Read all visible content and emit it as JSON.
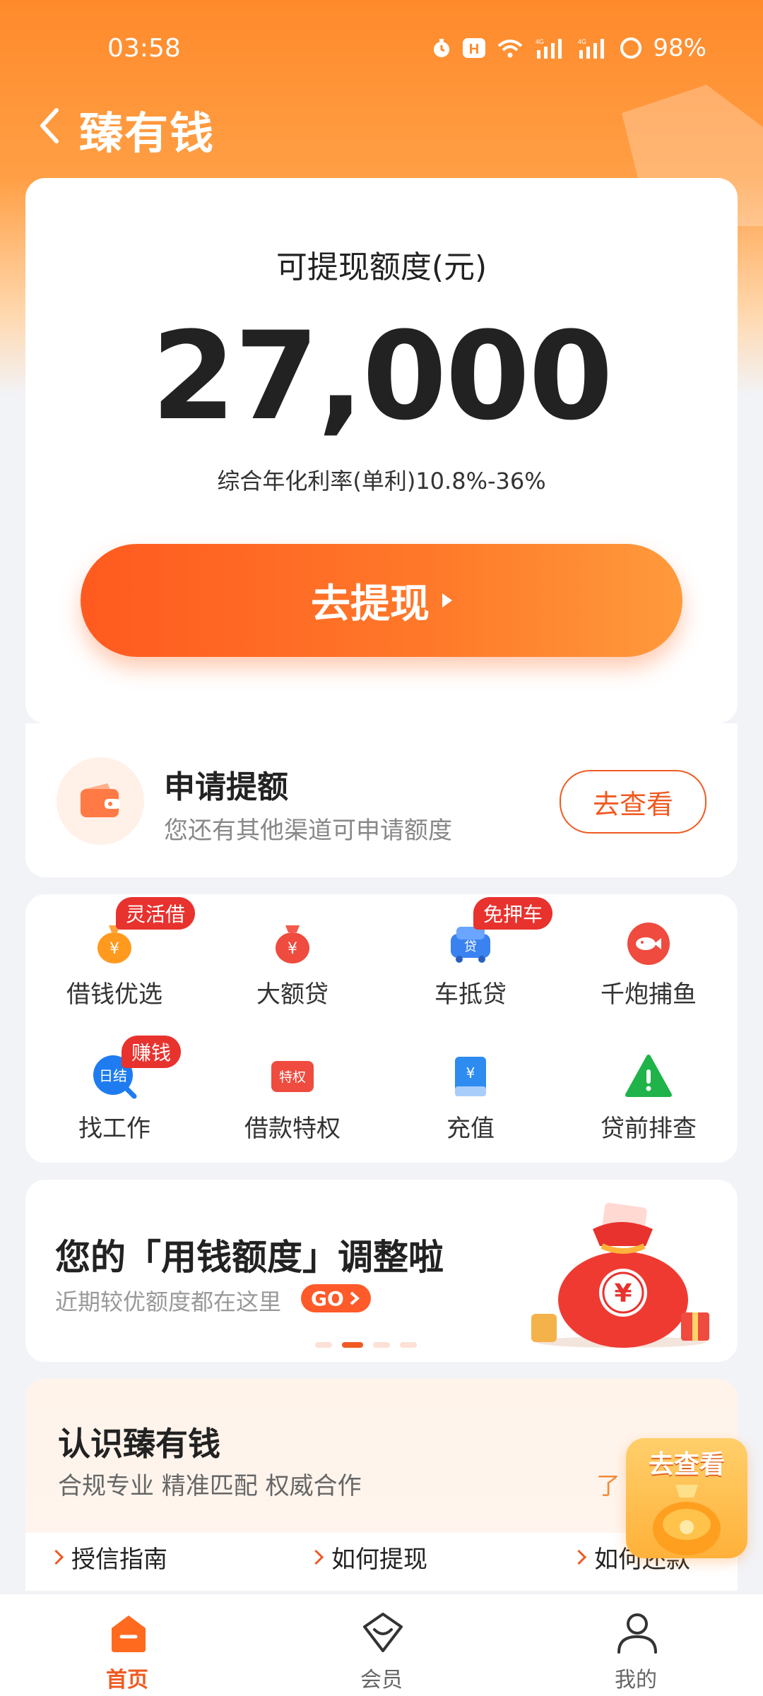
{
  "status_bar": {
    "time": "03:58",
    "battery": "98%",
    "icons": [
      "alarm-icon",
      "h-icon",
      "wifi-icon",
      "signal-4g-icon",
      "signal-4g-icon",
      "battery-icon"
    ]
  },
  "header": {
    "title": "臻有钱"
  },
  "credit": {
    "label": "可提现额度(元)",
    "amount": "27,000",
    "rate": "综合年化利率(单利)10.8%-36%",
    "withdraw_label": "去提现"
  },
  "apply": {
    "title": "申请提额",
    "subtitle": "您还有其他渠道可申请额度",
    "button": "去查看"
  },
  "services": [
    {
      "label": "借钱优选",
      "icon": "money-bag-icon",
      "badge": "灵活借"
    },
    {
      "label": "大额贷",
      "icon": "big-loan-icon",
      "badge": ""
    },
    {
      "label": "车抵贷",
      "icon": "car-loan-icon",
      "badge": "免押车"
    },
    {
      "label": "千炮捕鱼",
      "icon": "fish-icon",
      "badge": ""
    },
    {
      "label": "找工作",
      "icon": "job-search-icon",
      "badge": "赚钱",
      "icon_text": "日结"
    },
    {
      "label": "借款特权",
      "icon": "privilege-icon",
      "badge": "",
      "icon_text": "特权"
    },
    {
      "label": "充值",
      "icon": "recharge-icon",
      "badge": ""
    },
    {
      "label": "贷前排查",
      "icon": "warning-icon",
      "badge": ""
    }
  ],
  "banner": {
    "title": "您的「用钱额度」调整啦",
    "subtitle": "近期较优额度都在这里",
    "go_label": "GO",
    "page_count": 4,
    "active_page": 2
  },
  "about": {
    "title": "认识臻有钱",
    "subtitle": "合规专业 精准匹配 权威合作",
    "more": "了",
    "links": [
      "授信指南",
      "如何提现",
      "如何还款"
    ],
    "float_button": "去查看"
  },
  "bottom_nav": [
    {
      "label": "首页",
      "icon": "home-icon",
      "active": true
    },
    {
      "label": "会员",
      "icon": "member-icon",
      "active": false
    },
    {
      "label": "我的",
      "icon": "profile-icon",
      "active": false
    }
  ],
  "colors": {
    "brand_orange": "#ff6a1f",
    "accent_red": "#e8322e",
    "text_dark": "#222222"
  }
}
